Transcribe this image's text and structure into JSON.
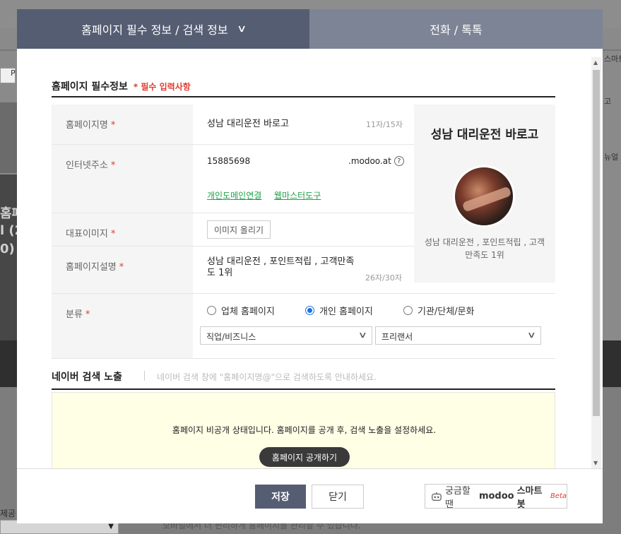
{
  "background": {
    "left_texts": [
      "홈페",
      "l (2",
      "0)"
    ],
    "right_texts": [
      "스마트봇",
      "고",
      "뉴얼"
    ],
    "left_bottom_text": "제공",
    "left_box_text": "P",
    "bottom_text": "모바일에서 더 편리하게 홈페이지를 관리할 수 있습니다."
  },
  "tabs": {
    "active_label": "홈페이지 필수 정보 / 검색 정보",
    "inactive_label": "전화 / 톡톡"
  },
  "required_section": {
    "title": "홈페이지 필수정보",
    "required_note": "* 필수 입력사항"
  },
  "form": {
    "name": {
      "label": "홈페이지명",
      "star": "*",
      "value": "성남 대리운전 바로고",
      "count": "11자/15자"
    },
    "url": {
      "label": "인터넷주소",
      "star": "*",
      "value": "15885698",
      "suffix": ".modoo.at",
      "help": "?",
      "link1": "개인도메인연결",
      "link2": "웹마스터도구"
    },
    "image": {
      "label": "대표이미지",
      "star": "*",
      "button": "이미지 올리기"
    },
    "desc": {
      "label": "홈페이지설명",
      "star": "*",
      "value_line1": "성남 대리운전 , 포인트적립 , 고객만족",
      "value_line2": "도 1위",
      "count": "26자/30자"
    },
    "category": {
      "label": "분류",
      "star": "*",
      "radios": [
        "업체 홈페이지",
        "개인 홈페이지",
        "기관/단체/문화"
      ],
      "selected_radio": "개인 홈페이지",
      "select1": "직업/비즈니스",
      "select2": "프리랜서"
    }
  },
  "preview": {
    "title": "성남 대리운전 바로고",
    "desc_line1": "성남 대리운전 , 포인트적립 , 고객",
    "desc_line2": "만족도 1위"
  },
  "naver": {
    "title": "네이버 검색 노출",
    "desc": "네이버 검색 창에 \"홈페이지명@\"으로 검색하도록 안내하세요.",
    "message": "홈페이지 비공개 상태입니다. 홈페이지를 공개 후, 검색 노출을 설정하세요.",
    "publish_button": "홈페이지 공개하기"
  },
  "footer": {
    "save": "저장",
    "close": "닫기",
    "smartbot_prefix": "궁금할 땐",
    "smartbot_brand": "modoo",
    "smartbot_suffix": "스마트봇",
    "smartbot_beta": "Beta"
  },
  "colors": {
    "tab_active": "#555d72",
    "tab_inactive": "#7d8496",
    "required_red": "#e03c31",
    "link_green": "#1fa24a",
    "notice_bg": "#ffffe6"
  }
}
